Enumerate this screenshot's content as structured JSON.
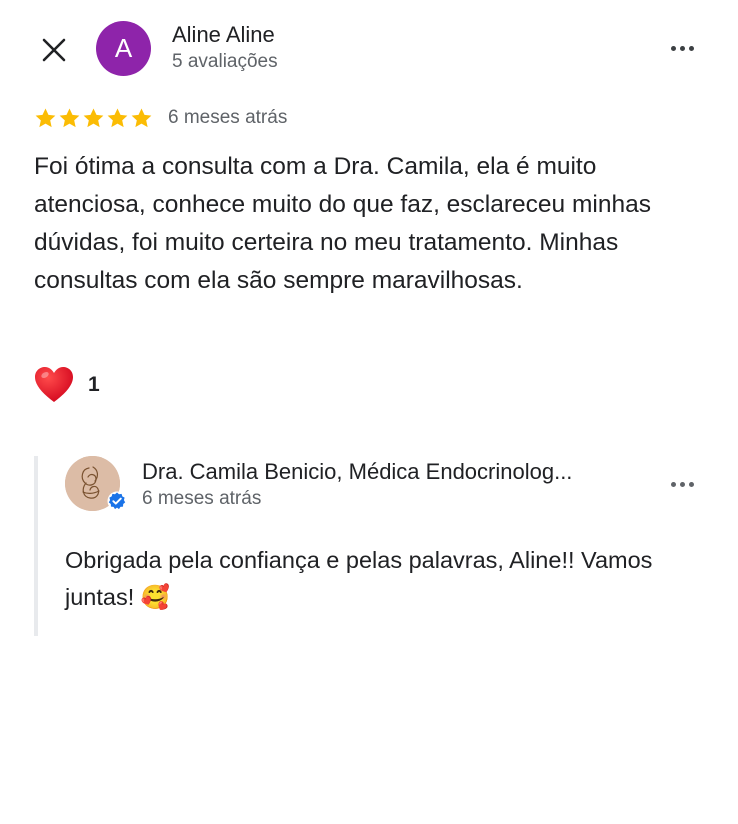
{
  "review": {
    "author_name": "Aline Aline",
    "author_initial": "A",
    "author_meta": "5 avaliações",
    "rating": 5,
    "time": "6 meses atrás",
    "text": "Foi ótima a consulta com a Dra. Camila, ela é muito atenciosa, conhece muito do que faz, esclareceu minhas dúvidas, foi muito certeira no meu tratamento. Minhas consultas com ela são sempre maravilhosas.",
    "reaction_emoji": "❤️",
    "reaction_count": "1"
  },
  "owner_reply": {
    "name": "Dra. Camila Benicio, Médica Endocrinolog...",
    "time": "6 meses atrás",
    "text": "Obrigada pela confiança e pelas palavras, Aline!! Vamos juntas! 🥰"
  },
  "icons": {
    "close": "close-icon",
    "more": "more-horizontal-icon",
    "star": "star-icon",
    "verified": "verified-badge-icon"
  },
  "colors": {
    "avatar": "#8e24aa",
    "star": "#fbbc04",
    "verified": "#1a73e8",
    "reply_bar": "#e8eaed",
    "secondary_text": "#5f6368"
  }
}
